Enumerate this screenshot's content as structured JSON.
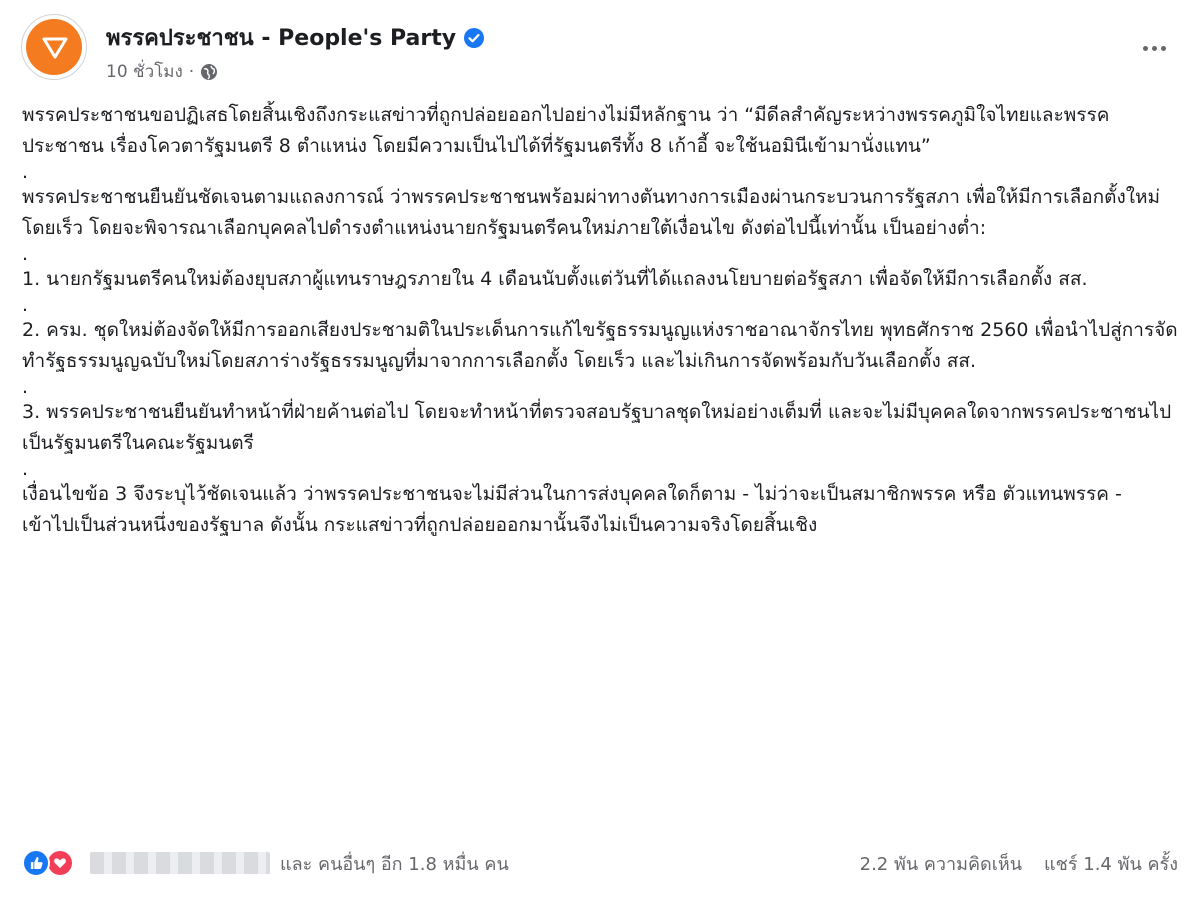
{
  "header": {
    "page_name": "พรรคประชาชน - People's Party",
    "time_ago": "10 ชั่วโมง",
    "separator": "·"
  },
  "icons": {
    "avatar": "party-logo",
    "verified": "verified-badge-icon",
    "privacy": "globe-icon",
    "more": "more-options-icon",
    "like": "like-reaction-icon",
    "love": "love-reaction-icon"
  },
  "colors": {
    "brand_orange": "#f47b20",
    "verified_blue": "#1877f2",
    "like_blue": "#1877f2",
    "love_red": "#f33e58",
    "secondary_text": "#65676b"
  },
  "post": {
    "paragraphs": [
      "พรรคประชาชนขอปฏิเสธโดยสิ้นเชิงถึงกระแสข่าวที่ถูกปล่อยออกไปอย่างไม่มีหลักฐาน ว่า “มีดีลสำคัญระหว่างพรรคภูมิใจไทยและพรรคประชาชน เรื่องโควตารัฐมนตรี 8 ตำแหน่ง โดยมีความเป็นไปได้ที่รัฐมนตรีทั้ง 8 เก้าอี้ จะใช้นอมินีเข้ามานั่งแทน”",
      "พรรคประชาชนยืนยันชัดเจนตามแถลงการณ์ ว่าพรรคประชาชนพร้อมผ่าทางตันทางการเมืองผ่านกระบวนการรัฐสภา เพื่อให้มีการเลือกตั้งใหม่โดยเร็ว โดยจะพิจารณาเลือกบุคคลไปดำรงตำแหน่งนายกรัฐมนตรีคนใหม่ภายใต้เงื่อนไข ดังต่อไปนี้เท่านั้น เป็นอย่างต่ำ:",
      "1. นายกรัฐมนตรีคนใหม่ต้องยุบสภาผู้แทนราษฎรภายใน 4 เดือนนับตั้งแต่วันที่ได้แถลงนโยบายต่อรัฐสภา เพื่อจัดให้มีการเลือกตั้ง สส.",
      "2. ครม. ชุดใหม่ต้องจัดให้มีการออกเสียงประชามติในประเด็นการแก้ไขรัฐธรรมนูญแห่งราชอาณาจักรไทย พุทธศักราช 2560 เพื่อนำไปสู่การจัดทำรัฐธรรมนูญฉบับใหม่โดยสภาร่างรัฐธรรมนูญที่มาจากการเลือกตั้ง โดยเร็ว และไม่เกินการจัดพร้อมกับวันเลือกตั้ง สส.",
      "3. พรรคประชาชนยืนยันทำหน้าที่ฝ่ายค้านต่อไป โดยจะทำหน้าที่ตรวจสอบรัฐบาลชุดใหม่อย่างเต็มที่ และจะไม่มีบุคคลใดจากพรรคประชาชนไปเป็นรัฐมนตรีในคณะรัฐมนตรี",
      "เงื่อนไขข้อ 3 จึงระบุไว้ชัดเจนแล้ว ว่าพรรคประชาชนจะไม่มีส่วนในการส่งบุคคลใดก็ตาม - ไม่ว่าจะเป็นสมาชิกพรรค หรือ ตัวแทนพรรค - เข้าไปเป็นส่วนหนึ่งของรัฐบาล ดังนั้น กระแสข่าวที่ถูกปล่อยออกมานั้นจึงไม่เป็นความจริงโดยสิ้นเชิง"
    ],
    "separator_dot": "."
  },
  "footer": {
    "reactions_text": "และ คนอื่นๆ อีก 1.8 หมื่น คน",
    "comments": "2.2 พัน ความคิดเห็น",
    "shares": "แชร์ 1.4 พัน ครั้ง"
  }
}
